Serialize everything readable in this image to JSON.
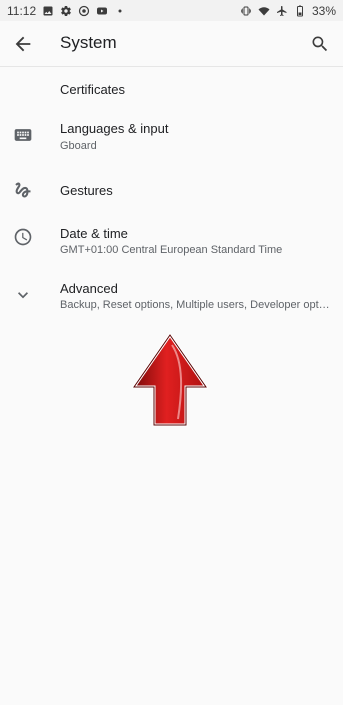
{
  "status_bar": {
    "time": "11:12",
    "battery": "33%",
    "left_icons": [
      "image-icon",
      "gear-icon",
      "vpn-key-icon",
      "youtube-icon",
      "dot-icon"
    ],
    "right_icons": [
      "vibrate-icon",
      "wifi-icon",
      "airplane-icon",
      "battery-icon"
    ]
  },
  "app_bar": {
    "title": "System",
    "back_icon": "arrow-back-icon",
    "search_icon": "search-icon"
  },
  "items": [
    {
      "label": "Certificates",
      "sub": "",
      "icon": ""
    },
    {
      "label": "Languages & input",
      "sub": "Gboard",
      "icon": "keyboard-icon"
    },
    {
      "label": "Gestures",
      "sub": "",
      "icon": "gesture-icon"
    },
    {
      "label": "Date & time",
      "sub": "GMT+01:00 Central European Standard Time",
      "icon": "clock-icon"
    },
    {
      "label": "Advanced",
      "sub": "Backup, Reset options, Multiple users, Developer options",
      "icon": "chevron-down-icon"
    }
  ],
  "colors": {
    "background": "#fafafa",
    "status_bar": "#f2f2f2",
    "arrow_red": "#d11a1a"
  }
}
